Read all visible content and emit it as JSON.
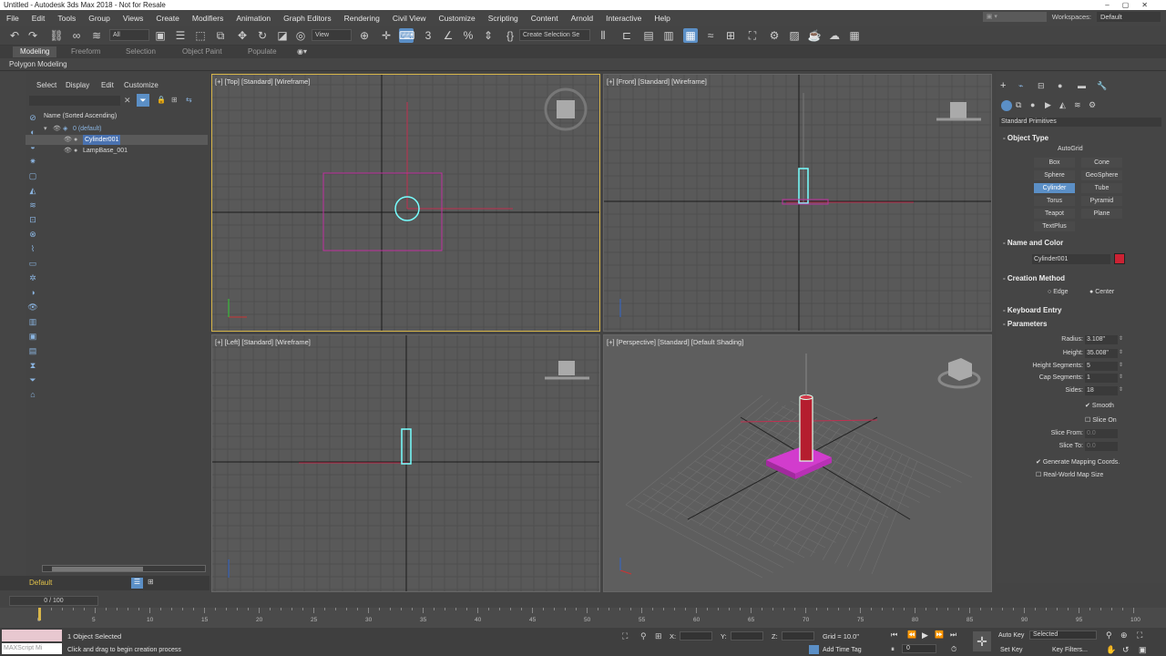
{
  "title": "Untitled - Autodesk 3ds Max 2018 - Not for Resale",
  "menu": [
    "File",
    "Edit",
    "Tools",
    "Group",
    "Views",
    "Create",
    "Modifiers",
    "Animation",
    "Graph Editors",
    "Rendering",
    "Civil View",
    "Customize",
    "Scripting",
    "Content",
    "Arnold",
    "Interactive",
    "Help"
  ],
  "workspaces_label": "Workspaces:",
  "workspace_value": "Default",
  "toolbar": {
    "filter_value": "All",
    "view_value": "View",
    "selection_set_placeholder": "Create Selection Se"
  },
  "ribbon_tabs": [
    "Modeling",
    "Freeform",
    "Selection",
    "Object Paint",
    "Populate"
  ],
  "ribbon_sub": "Polygon Modeling",
  "scene_explorer": {
    "menu": [
      "Select",
      "Display",
      "Edit",
      "Customize"
    ],
    "header": "Name (Sorted Ascending)",
    "items": [
      "0 (default)",
      "Cylinder001",
      "LampBase_001"
    ],
    "layer": "Default"
  },
  "viewports": {
    "top": "[+] [Top] [Standard] [Wireframe]",
    "front": "[+] [Front] [Standard] [Wireframe]",
    "left": "[+] [Left] [Standard] [Wireframe]",
    "perspective": "[+] [Perspective] [Standard] [Default Shading]"
  },
  "command_panel": {
    "dropdown": "Standard Primitives",
    "object_type_title": "Object Type",
    "autogrid": "AutoGrid",
    "buttons": [
      "Box",
      "Cone",
      "Sphere",
      "GeoSphere",
      "Cylinder",
      "Tube",
      "Torus",
      "Pyramid",
      "Teapot",
      "Plane",
      "TextPlus"
    ],
    "active_button": "Cylinder",
    "name_color_title": "Name and Color",
    "object_name": "Cylinder001",
    "object_color": "#cc2233",
    "creation_method_title": "Creation Method",
    "creation_edge": "Edge",
    "creation_center": "Center",
    "keyboard_entry_title": "Keyboard Entry",
    "parameters_title": "Parameters",
    "params": [
      {
        "label": "Radius:",
        "value": "3.108\""
      },
      {
        "label": "Height:",
        "value": "35.008\""
      },
      {
        "label": "Height Segments:",
        "value": "5"
      },
      {
        "label": "Cap Segments:",
        "value": "1"
      },
      {
        "label": "Sides:",
        "value": "18"
      }
    ],
    "smooth": "Smooth",
    "slice_on": "Slice On",
    "slice_from_label": "Slice From:",
    "slice_from_value": "0.0",
    "slice_to_label": "Slice To:",
    "slice_to_value": "0.0",
    "gen_mapping": "Generate Mapping Coords.",
    "real_world": "Real-World Map Size"
  },
  "timeline": {
    "frame": "0 / 100",
    "ticks": [
      "0",
      "5",
      "10",
      "15",
      "20",
      "25",
      "30",
      "35",
      "40",
      "45",
      "50",
      "55",
      "60",
      "65",
      "70",
      "75",
      "80",
      "85",
      "90",
      "95",
      "100"
    ]
  },
  "status": {
    "selected": "1 Object Selected",
    "prompt": "Click and drag to begin creation process",
    "script_label": "MAXScript Mi",
    "x_label": "X:",
    "y_label": "Y:",
    "z_label": "Z:",
    "grid": "Grid = 10.0\"",
    "add_time_tag": "Add Time Tag",
    "auto_key": "Auto Key",
    "set_key": "Set Key",
    "selected_dd": "Selected",
    "key_filters": "Key Filters...",
    "time_value": "0"
  },
  "colors": {
    "accent": "#5b8fc6",
    "active_border": "#d8b64a",
    "selection_magenta": "#c030a0",
    "cylinder_red": "#cc2233"
  }
}
